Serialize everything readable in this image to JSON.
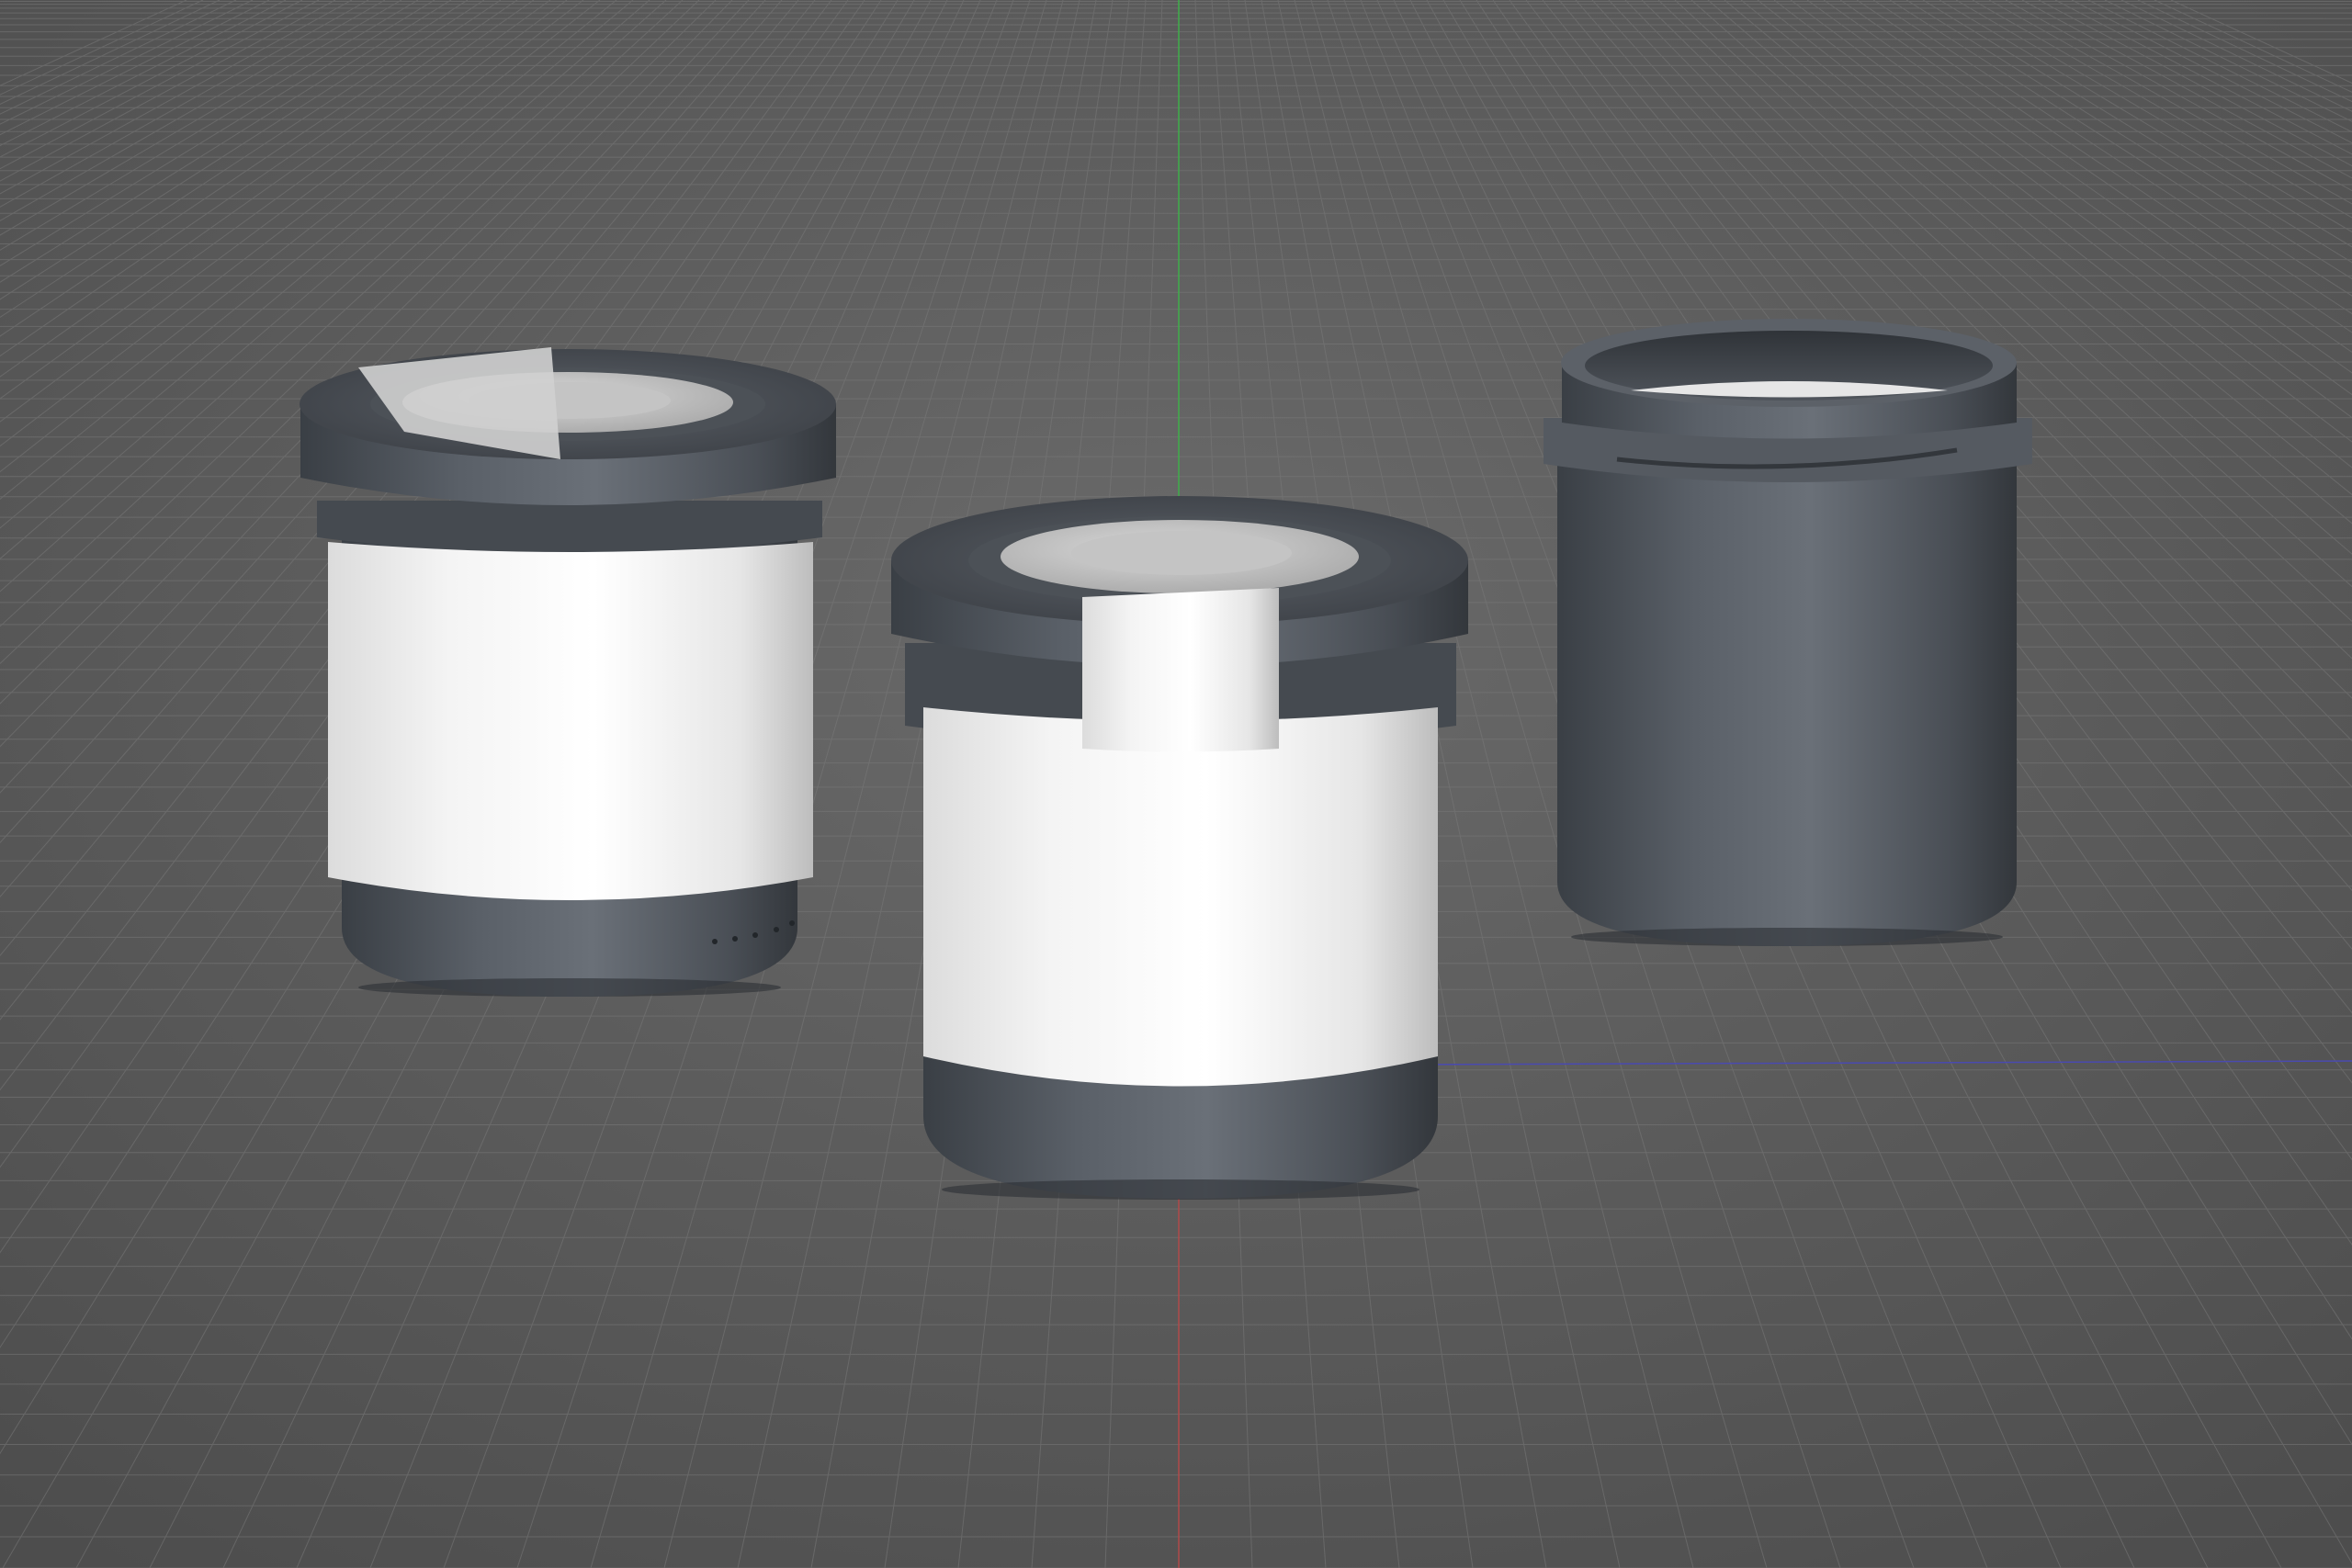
{
  "viewport": {
    "view": "perspective",
    "grid": true,
    "axis_colors": {
      "x": "#b04a4a",
      "y": "#3fae4a",
      "z": "#4a4ab0"
    },
    "background": "#5a5a5a"
  },
  "scene": {
    "objects": [
      {
        "name": "jar-with-lid-and-seal-strip",
        "lid": true,
        "label": true,
        "seal_strip": "lid-top"
      },
      {
        "name": "jar-with-lid-and-front-seal",
        "lid": true,
        "label": true,
        "seal_strip": "front"
      },
      {
        "name": "open-jar-no-lid",
        "lid": false,
        "label": false,
        "seal_strip": "none"
      }
    ],
    "material_colors": {
      "body": "#4a4f55",
      "label": "#f2f2f2",
      "lid_disc": "#cfcfcf"
    }
  }
}
